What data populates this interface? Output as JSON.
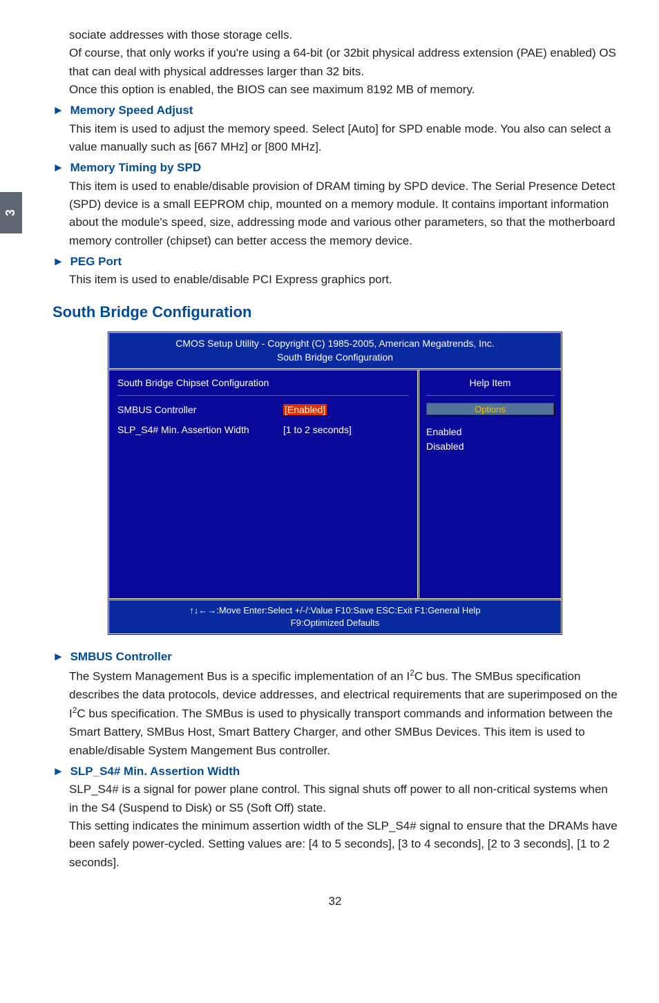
{
  "sideTab": "3",
  "intro": {
    "line1": "sociate addresses with those storage cells.",
    "line2": "Of course, that only works if you're using a 64-bit (or 32bit physical address extension (PAE) enabled) OS that can deal with physical addresses larger than 32 bits.",
    "line3": "Once this option is enabled, the BIOS can see maximum 8192 MB of memory."
  },
  "memSpeed": {
    "title": "Memory Speed Adjust",
    "body": "This item is used to adjust the memory speed. Select [Auto] for SPD enable mode. You also can select a value manually such as [667 MHz] or [800 MHz]."
  },
  "memTiming": {
    "title": "Memory Timing by SPD",
    "body": "This item is used to enable/disable provision of DRAM timing by SPD device. The Serial Presence Detect (SPD) device is a small EEPROM chip, mounted on a memory module. It contains important information about the module's speed, size, addressing mode and various other parameters, so that the motherboard memory controller (chipset) can better access the memory device."
  },
  "pegPort": {
    "title": "PEG Port",
    "body": "This item is used to enable/disable PCI Express graphics port."
  },
  "sectionTitle": "South Bridge Configuration",
  "bios": {
    "titleLine1": "CMOS Setup Utility - Copyright (C) 1985-2005, American Megatrends, Inc.",
    "titleLine2": "South Bridge Configuration",
    "leftHeader": "South Bridge Chipset Configuration",
    "rightHeader": "Help Item",
    "optionsLabel": "Options",
    "row1": {
      "label": "SMBUS Controller",
      "value": "[Enabled]"
    },
    "row2": {
      "label": "SLP_S4# Min. Assertion Width",
      "value": "[1 to 2 seconds]"
    },
    "optEnabled": "Enabled",
    "optDisabled": "Disabled",
    "footLine1": "↑↓←→:Move   Enter:Select   +/-/:Value   F10:Save   ESC:Exit    F1:General Help",
    "footLine2": "F9:Optimized Defaults"
  },
  "smbus": {
    "title": "SMBUS Controller",
    "body_a": "The System Management Bus is a specific implementation of an I",
    "body_b": "C bus. The SMBus specification describes the data protocols, device addresses, and electrical requirements that are superimposed on the I",
    "body_c": "C bus specification. The SMBus is used to physically transport commands and information between the Smart Battery, SMBus Host, Smart Battery Charger, and other SMBus Devices. This item is used to enable/disable System Mangement Bus controller."
  },
  "slp": {
    "title": "SLP_S4# Min. Assertion Width",
    "body1": "SLP_S4# is a signal for power plane control. This signal shuts off power to all non-critical systems when in the S4 (Suspend to Disk) or S5 (Soft Off) state.",
    "body2": "This setting indicates the minimum assertion width of the SLP_S4# signal to ensure that the DRAMs have been safely power-cycled. Setting values are: [4 to 5 seconds],  [3 to 4 seconds], [2 to 3 seconds],  [1 to 2 seconds]."
  },
  "pageNum": "32"
}
